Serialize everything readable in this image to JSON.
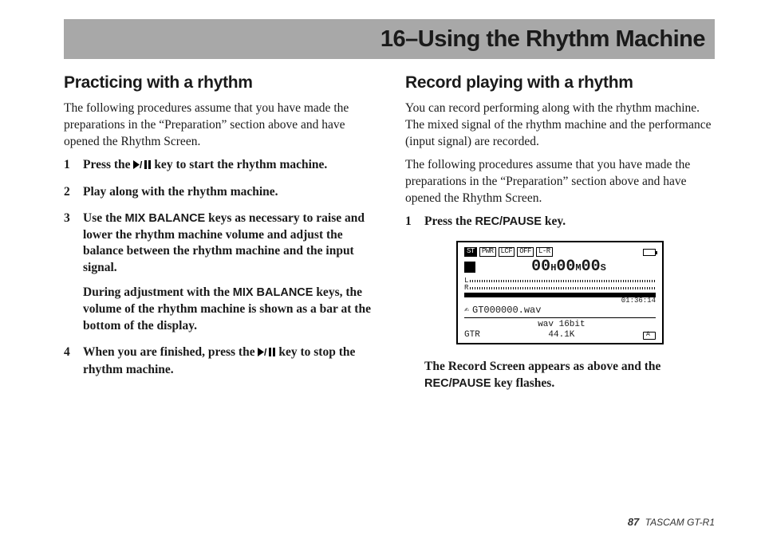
{
  "chapter": {
    "title": "16–Using the Rhythm Machine"
  },
  "left": {
    "heading": "Practicing with a rhythm",
    "intro": "The following procedures assume that you have made the preparations in the “Preparation” section above and have opened the Rhythm Screen.",
    "steps": {
      "s1_a": "Press the ",
      "s1_b": " key to start the rhythm machine.",
      "s2": "Play along with the rhythm machine.",
      "s3_a": "Use the ",
      "s3_key1": "MIX BALANCE",
      "s3_b": " keys as necessary to raise and lower the rhythm machine volume and adjust the balance between the rhythm machine and the input signal.",
      "s3_sub_a": "During adjustment with the ",
      "s3_key2": "MIX BALANCE",
      "s3_sub_b": " keys, the volume of the rhythm machine is shown as a bar at the bottom of the display.",
      "s4_a": "When you are finished, press the ",
      "s4_b": " key to stop the rhythm machine."
    }
  },
  "right": {
    "heading": "Record playing with a rhythm",
    "p1": "You can record performing along with the rhythm machine. The mixed signal of the rhythm machine and the performance (input signal) are recorded.",
    "p2": "The following procedures assume that you have made the preparations in the “Preparation” section above and have opened the Rhythm Screen.",
    "steps": {
      "s1_a": "Press the ",
      "s1_key": "REC/PAUSE",
      "s1_b": " key."
    },
    "after_a": "The Record Screen appears as above and the ",
    "after_key": "REC/PAUSE",
    "after_b": " key flashes."
  },
  "lcd": {
    "chips": {
      "c1": "ST",
      "c2": "PWR",
      "c3": "LCF",
      "c4": "OFF",
      "c5": "L-R"
    },
    "time_h": "00",
    "time_hu": "H",
    "time_m": "00",
    "time_mu": "M",
    "time_s": "00",
    "time_su": "S",
    "remain": "01:36:14",
    "file": "GT000000.wav",
    "fmt1": "wav 16bit",
    "fmt2": "44.1K",
    "gtr": "GTR"
  },
  "footer": {
    "page": "87",
    "model": "TASCAM  GT-R1"
  }
}
